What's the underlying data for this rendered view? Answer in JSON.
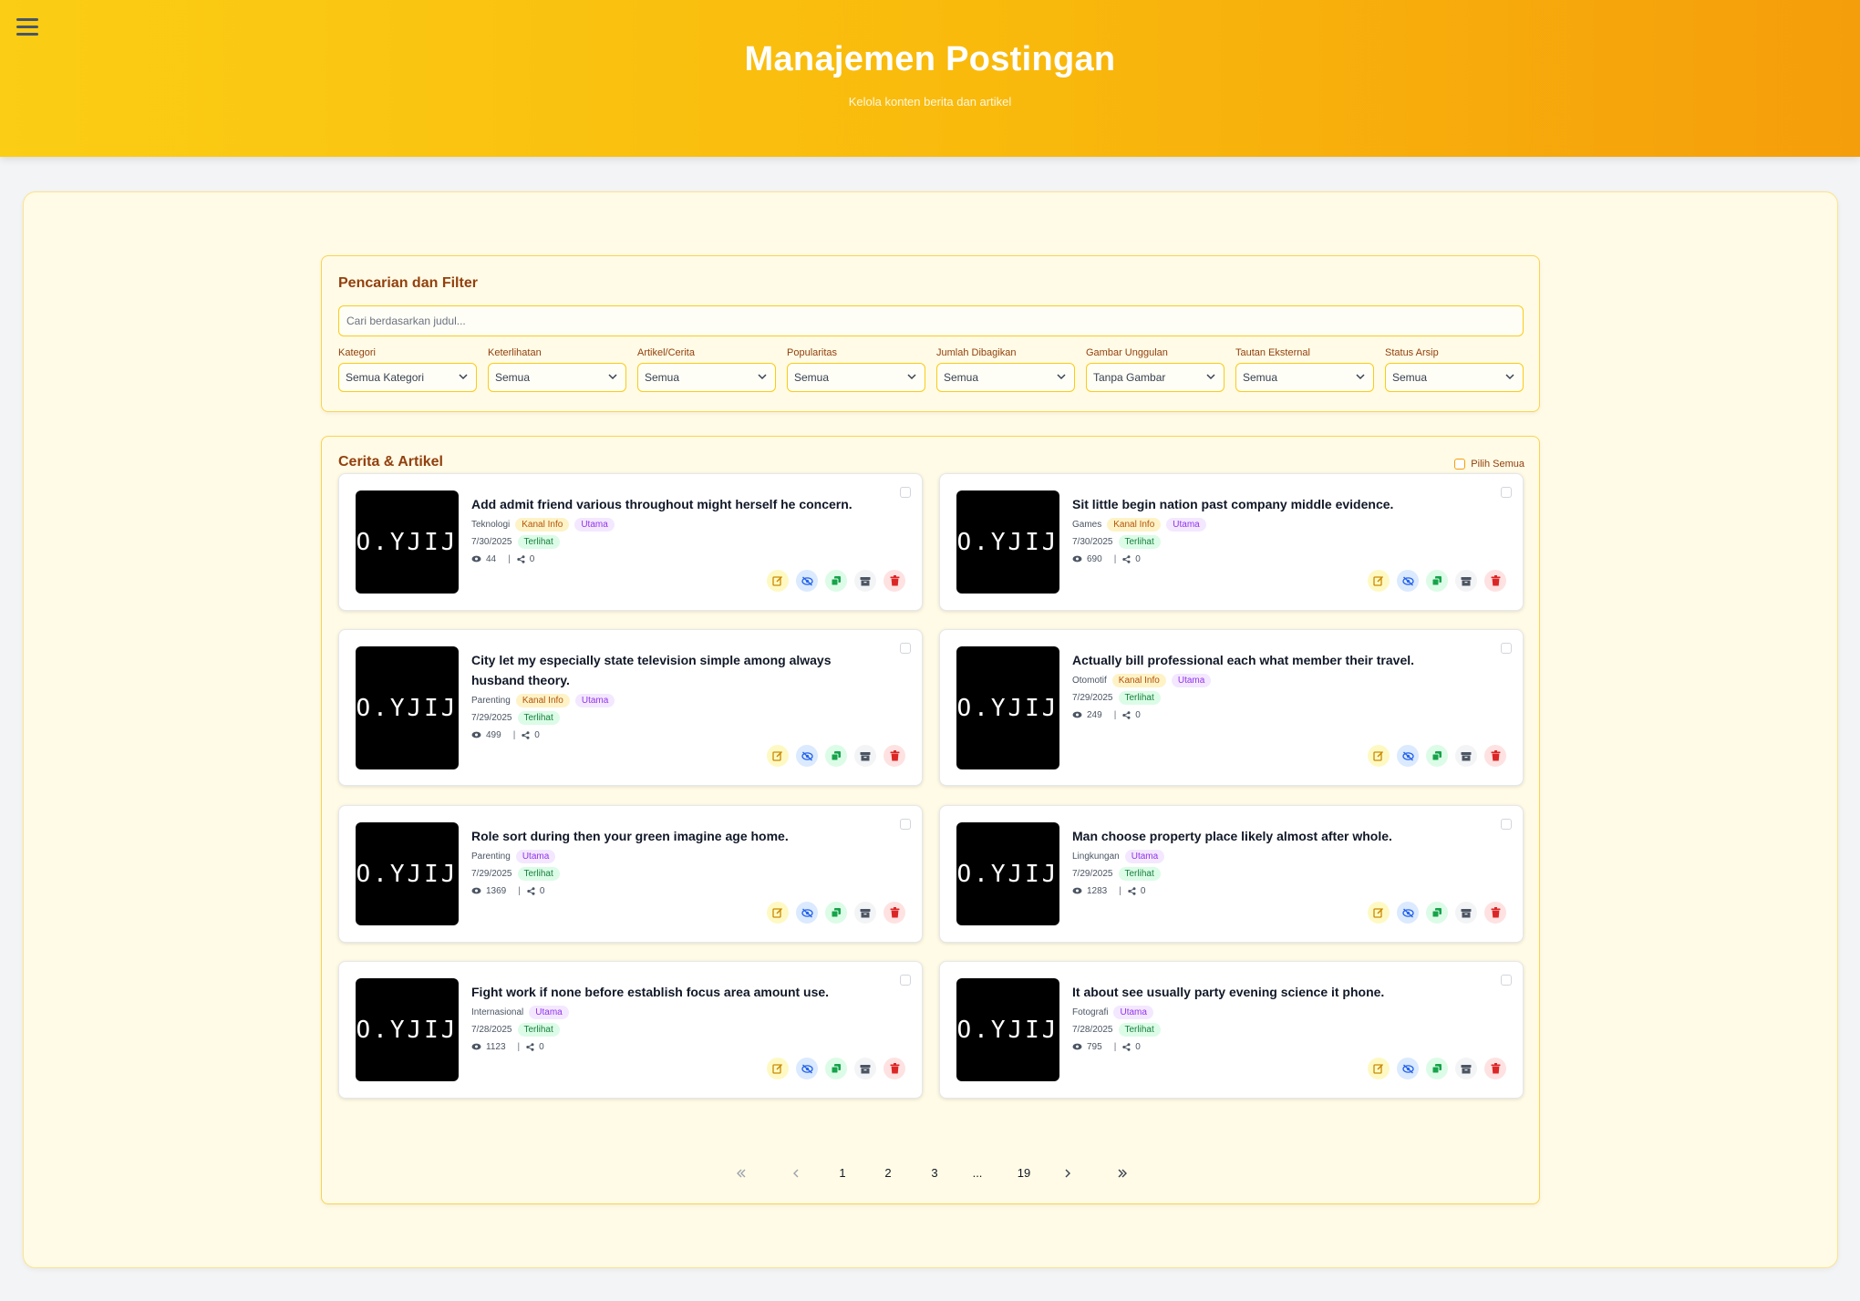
{
  "header": {
    "title": "Manajemen Postingan",
    "subtitle": "Kelola konten berita dan artikel"
  },
  "filters": {
    "section_title": "Pencarian dan Filter",
    "search_placeholder": "Cari berdasarkan judul...",
    "search_value": "",
    "groups": [
      {
        "label": "Kategori",
        "value": "Semua Kategori"
      },
      {
        "label": "Keterlihatan",
        "value": "Semua"
      },
      {
        "label": "Artikel/Cerita",
        "value": "Semua"
      },
      {
        "label": "Popularitas",
        "value": "Semua"
      },
      {
        "label": "Jumlah Dibagikan",
        "value": "Semua"
      },
      {
        "label": "Gambar Unggulan",
        "value": "Tanpa Gambar"
      },
      {
        "label": "Tautan Eksternal",
        "value": "Semua"
      },
      {
        "label": "Status Arsip",
        "value": "Semua"
      }
    ]
  },
  "list": {
    "title": "Cerita & Artikel",
    "select_all_label": "Pilih Semua",
    "thumbnail_text": "O.YJIJ",
    "posts": [
      {
        "title": "Add admit friend various throughout might herself he concern.",
        "category": "Teknologi",
        "kanal_info": "Kanal Info",
        "utama": "Utama",
        "date": "7/30/2025",
        "status": "Terlihat",
        "views": "44",
        "shares": "0"
      },
      {
        "title": "Sit little begin nation past company middle evidence.",
        "category": "Games",
        "kanal_info": "Kanal Info",
        "utama": "Utama",
        "date": "7/30/2025",
        "status": "Terlihat",
        "views": "690",
        "shares": "0"
      },
      {
        "title": "City let my especially state television simple among always husband theory.",
        "category": "Parenting",
        "kanal_info": "Kanal Info",
        "utama": "Utama",
        "date": "7/29/2025",
        "status": "Terlihat",
        "views": "499",
        "shares": "0"
      },
      {
        "title": "Actually bill professional each what member their travel.",
        "category": "Otomotif",
        "kanal_info": "Kanal Info",
        "utama": "Utama",
        "date": "7/29/2025",
        "status": "Terlihat",
        "views": "249",
        "shares": "0"
      },
      {
        "title": "Role sort during then your green imagine age home.",
        "category": "Parenting",
        "kanal_info": null,
        "utama": "Utama",
        "date": "7/29/2025",
        "status": "Terlihat",
        "views": "1369",
        "shares": "0"
      },
      {
        "title": "Man choose property place likely almost after whole.",
        "category": "Lingkungan",
        "kanal_info": null,
        "utama": "Utama",
        "date": "7/29/2025",
        "status": "Terlihat",
        "views": "1283",
        "shares": "0"
      },
      {
        "title": "Fight work if none before establish focus area amount use.",
        "category": "Internasional",
        "kanal_info": null,
        "utama": "Utama",
        "date": "7/28/2025",
        "status": "Terlihat",
        "views": "1123",
        "shares": "0"
      },
      {
        "title": "It about see usually party evening science it phone.",
        "category": "Fotografi",
        "kanal_info": null,
        "utama": "Utama",
        "date": "7/28/2025",
        "status": "Terlihat",
        "views": "795",
        "shares": "0"
      }
    ]
  },
  "pagination": {
    "pages": [
      "1",
      "2",
      "3"
    ],
    "ellipsis": "...",
    "last_page": "19"
  }
}
